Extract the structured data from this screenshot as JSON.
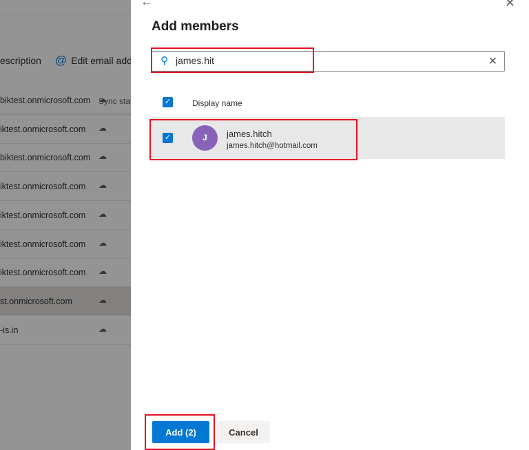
{
  "background": {
    "toolbar": {
      "description_label": "escription",
      "edit_email_label": "Edit email addre"
    },
    "column_header": "Sync stat",
    "rows": [
      {
        "email": "biktest.onmicrosoft.com",
        "selected": false
      },
      {
        "email": "iktest.onmicrosoft.com",
        "selected": false
      },
      {
        "email": "biktest.onmicrosoft.com",
        "selected": false
      },
      {
        "email": "iktest.onmicrosoft.com",
        "selected": false
      },
      {
        "email": "iktest.onmicrosoft.com",
        "selected": false
      },
      {
        "email": "iktest.onmicrosoft.com",
        "selected": false
      },
      {
        "email": "iktest.onmicrosoft.com",
        "selected": false
      },
      {
        "email": "st.onmicrosoft.com",
        "selected": true
      },
      {
        "email": "-is.in",
        "selected": false
      }
    ],
    "sync_icon": "cloud-icon"
  },
  "panel": {
    "title": "Add members",
    "search": {
      "value": "james.hit"
    },
    "column_header": "Display name",
    "members": [
      {
        "initial": "J",
        "name": "james.hitch",
        "email": "james.hitch@hotmail.com",
        "checked": true
      }
    ],
    "add_label": "Add (2)",
    "cancel_label": "Cancel"
  },
  "colors": {
    "accent": "#0078d4",
    "avatar": "#8764b8",
    "highlight": "#e81123"
  }
}
